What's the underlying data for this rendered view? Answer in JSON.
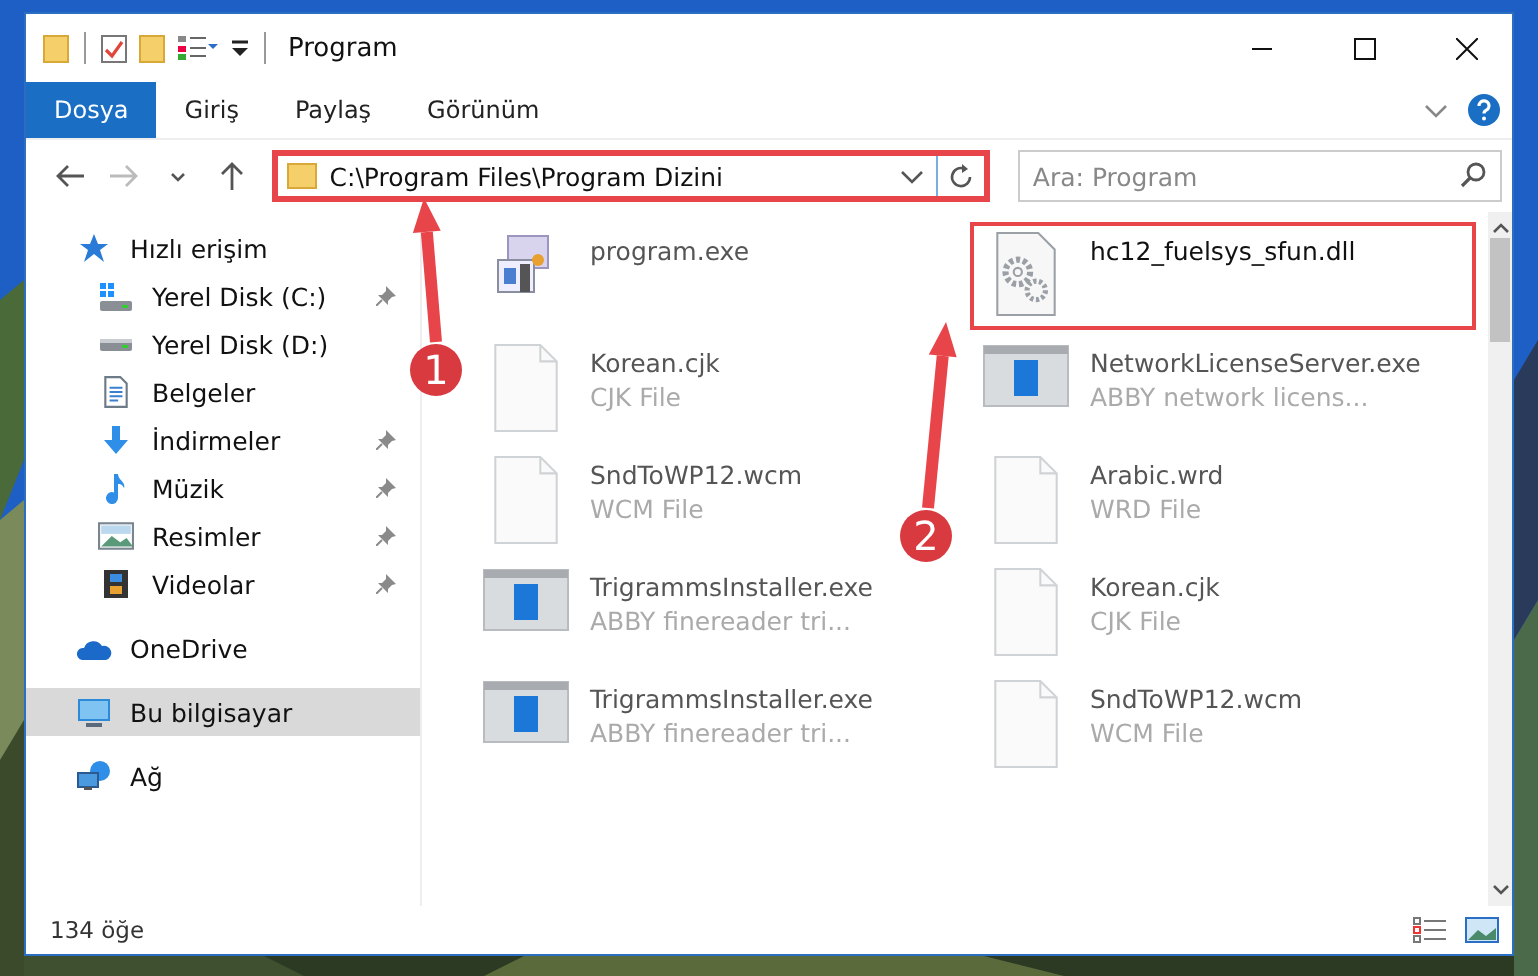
{
  "window": {
    "title": "Program"
  },
  "ribbon_tabs": [
    {
      "label": "Dosya",
      "selected": true
    },
    {
      "label": "Giriş",
      "selected": false
    },
    {
      "label": "Paylaş",
      "selected": false
    },
    {
      "label": "Görünüm",
      "selected": false
    }
  ],
  "address": {
    "path": "C:\\Program Files\\Program Dizini",
    "highlighted": true
  },
  "search": {
    "placeholder": "Ara: Program"
  },
  "nav": [
    {
      "label": "Hızlı erişim",
      "kind": "star",
      "selected": false,
      "children": [
        {
          "label": "Yerel Disk (C:)",
          "kind": "systemdrive",
          "pinned": true,
          "selected": false
        },
        {
          "label": "Yerel Disk (D:)",
          "kind": "drive",
          "pinned": false,
          "selected": false
        },
        {
          "label": "Belgeler",
          "kind": "document",
          "pinned": false,
          "selected": false
        },
        {
          "label": "İndirmeler",
          "kind": "download",
          "pinned": true,
          "selected": false
        },
        {
          "label": "Müzik",
          "kind": "music",
          "pinned": true,
          "selected": false
        },
        {
          "label": "Resimler",
          "kind": "pictures",
          "pinned": true,
          "selected": false
        },
        {
          "label": "Videolar",
          "kind": "video",
          "pinned": true,
          "selected": false
        }
      ]
    },
    {
      "label": "OneDrive",
      "kind": "cloud",
      "selected": false
    },
    {
      "label": "Bu bilgisayar",
      "kind": "computer",
      "selected": true
    },
    {
      "label": "Ağ",
      "kind": "network",
      "selected": false
    }
  ],
  "files": [
    {
      "name": "program.exe",
      "kind": "setup",
      "highlighted": false
    },
    {
      "name": "hc12_fuelsys_sfun.dll",
      "kind": "dll",
      "highlighted": true
    },
    {
      "name": "Korean.cjk",
      "type": "CJK File",
      "kind": "blank",
      "highlighted": false
    },
    {
      "name": "NetworkLicenseServer.exe",
      "type": "ABBY network licens...",
      "kind": "app",
      "highlighted": false
    },
    {
      "name": "SndToWP12.wcm",
      "type": "WCM File",
      "kind": "blank",
      "highlighted": false
    },
    {
      "name": "Arabic.wrd",
      "type": "WRD File",
      "kind": "blank",
      "highlighted": false
    },
    {
      "name": "TrigrammsInstaller.exe",
      "type": "ABBY finereader tri...",
      "kind": "app",
      "highlighted": false
    },
    {
      "name": "Korean.cjk",
      "type": "CJK File",
      "kind": "blank",
      "highlighted": false
    },
    {
      "name": "TrigrammsInstaller.exe",
      "type": "ABBY finereader tri...",
      "kind": "app",
      "highlighted": false
    },
    {
      "name": "SndToWP12.wcm",
      "type": "WCM File",
      "kind": "blank",
      "highlighted": false
    }
  ],
  "callouts": [
    {
      "label": "1"
    },
    {
      "label": "2"
    }
  ],
  "status_bar": {
    "item_count": "134 öğe"
  }
}
